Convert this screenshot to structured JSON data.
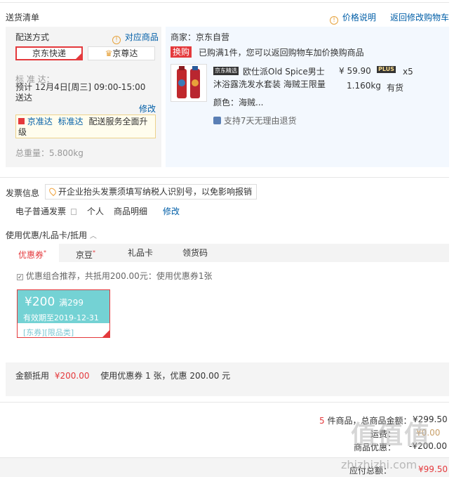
{
  "header": {
    "title": "送货清单",
    "price_explain": "价格说明",
    "back_to_cart": "返回修改购物车"
  },
  "shipping": {
    "method_label": "配送方式",
    "match_goods": "对应商品",
    "options": [
      "京东快递",
      "京尊达"
    ],
    "standard_label": "标 准 达：",
    "estimate": "预计 12月4日[周三] 09:00-15:00 送达",
    "modify": "修改",
    "jzd_tag": "京准达",
    "jzd_text": "标准达",
    "jzd_desc": "配送服务全面升级",
    "total_weight": "总重量：5.800kg"
  },
  "merchant": {
    "name": "商家：京东自营",
    "swap_badge": "换购",
    "swap_text": "已购满1件，您可以返回购物车加价换购商品",
    "product": {
      "tag": "京东精选",
      "name": "欧仕派Old Spice男士沐浴露洗发水套装 海贼王限量",
      "price": "¥ 59.90",
      "plus": "PLUS",
      "qty": "x5",
      "weight": "1.160kg",
      "stock": "有货",
      "color": "颜色：海贼...",
      "return_policy": "支持7天无理由退货"
    }
  },
  "invoice": {
    "label": "发票信息",
    "tip": "开企业抬头发票须填写纳税人识别号，以免影响报销",
    "type": "电子普通发票",
    "holder": "个人",
    "detail": "商品明细",
    "modify": "修改"
  },
  "discount": {
    "title": "使用优惠/礼品卡/抵用",
    "tabs": [
      "优惠券",
      "京豆",
      "礼品卡",
      "领货码"
    ],
    "recommend": "优惠组合推荐，共抵用200.00元：使用优惠券1张",
    "coupon": {
      "amount": "¥200",
      "condition": "满299",
      "validity": "有效期至2019-12-31",
      "tags": "[东券][限品类]"
    },
    "summary_label": "金额抵用",
    "summary_amount": "¥200.00",
    "summary_desc": "使用优惠券 1 张，优惠 200.00 元"
  },
  "totals": {
    "count": "5",
    "count_label": "件商品，总商品金额：",
    "goods_total": "¥299.50",
    "freight_label": "运费：",
    "freight": "¥0.00",
    "discount_label": "商品优惠：",
    "discount": "-¥200.00",
    "payable_label": "应付总额：",
    "payable": "¥99.50"
  },
  "watermark": {
    "main": "值值值",
    "sub": "zhizhizhi.com"
  }
}
